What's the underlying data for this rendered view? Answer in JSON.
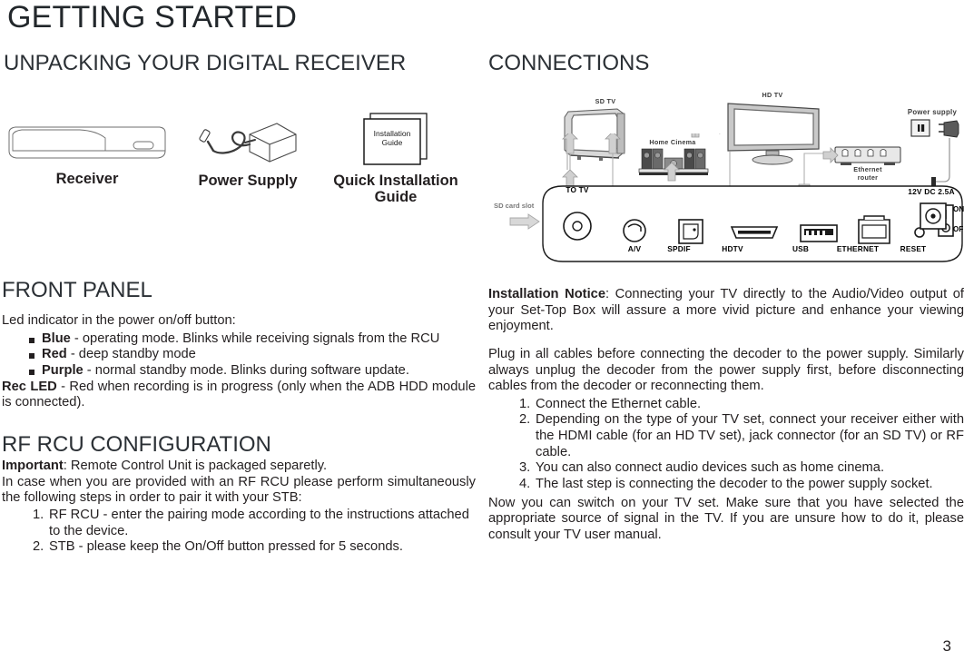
{
  "page": {
    "title": "GETTING STARTED",
    "number": "3"
  },
  "left": {
    "unpacking_heading": "UNPACKING YOUR DIGITAL RECEIVER",
    "items": [
      {
        "caption": "Receiver",
        "icon": "receiver-box-illustration"
      },
      {
        "caption": "Power Supply",
        "icon": "power-adapter-illustration"
      },
      {
        "caption": "Quick Installation Guide",
        "icon": "installation-guide-booklet-illustration",
        "booklet_line1": "Installation",
        "booklet_line2": "Guide"
      }
    ],
    "front_panel": {
      "heading": "FRONT PANEL",
      "intro": "Led indicator in the power on/off button:",
      "bullets": [
        {
          "term": "Blue",
          "rest": " - operating mode. Blinks while receiving signals from the RCU"
        },
        {
          "term": "Red",
          "rest": " - deep standby mode"
        },
        {
          "term": "Purple",
          "rest": " - normal standby mode. Blinks during software update."
        }
      ],
      "rec_led_term": "Rec LED",
      "rec_led_rest": " - Red when recording is in progress (only when the ADB HDD module is connected)."
    },
    "rf_rcu": {
      "heading": "RF RCU CONFIGURATION",
      "important_term": "Important",
      "important_rest": ": Remote Control Unit is packaged separetly.",
      "paragraph": "In case when you are provided with an RF RCU please perform simultaneously the following steps in order to pair it with your STB:",
      "steps": [
        "RF RCU - enter the pairing mode according to the instructions attached to the device.",
        "STB - please keep the On/Off button pressed for 5 seconds."
      ]
    }
  },
  "right": {
    "connections_heading": "CONNECTIONS",
    "diagram": {
      "device_labels": [
        {
          "name": "sd-tv",
          "text": "SD TV"
        },
        {
          "name": "home-cinema",
          "text": "Home Cinema"
        },
        {
          "name": "hd-tv",
          "text": "HD TV"
        },
        {
          "name": "ethernet-router-line1",
          "text": "Ethernet"
        },
        {
          "name": "ethernet-router-line2",
          "text": "router"
        },
        {
          "name": "power-supply",
          "text": "Power supply"
        }
      ],
      "sd_card_slot": "SD card slot",
      "ports": [
        {
          "name": "to-tv",
          "text": "TO TV"
        },
        {
          "name": "av",
          "text": "A/V"
        },
        {
          "name": "spdif",
          "text": "SPDIF"
        },
        {
          "name": "hdtv",
          "text": "HDTV"
        },
        {
          "name": "usb",
          "text": "USB"
        },
        {
          "name": "ethernet",
          "text": "ETHERNET"
        },
        {
          "name": "reset",
          "text": "RESET"
        }
      ],
      "power_switch_on": "ON",
      "power_switch_off": "OFF",
      "dc_jack": "12V DC 2.5A"
    },
    "notice_term": "Installation Notice",
    "notice_rest": ": Connecting your TV directly to the Audio/Video output of your Set-Top Box will assure a more vivid picture and enhance your viewing enjoyment.",
    "plug_paragraph": "Plug in all cables before connecting the decoder to the power supply. Similarly always unplug the decoder from the power supply first, before disconnecting cables from the decoder or reconnecting them.",
    "steps": [
      "Connect the Ethernet cable.",
      "Depending on the type of your TV set, connect your receiver either with the HDMI cable (for an HD TV set), jack connector (for an SD TV) or RF cable.",
      "You can also connect audio devices such as home cinema.",
      "The last step is connecting the decoder to the power supply socket."
    ],
    "closing_paragraph": "Now you can switch on your TV set. Make sure that you have selected the appropriate source of signal in the TV. If you are unsure how to do it, please consult your TV user manual."
  },
  "colors": {
    "text": "#231f20",
    "heading": "#2b3035",
    "diagram_gray": "#8a8a8a",
    "diagram_dark": "#4a4a4a"
  }
}
